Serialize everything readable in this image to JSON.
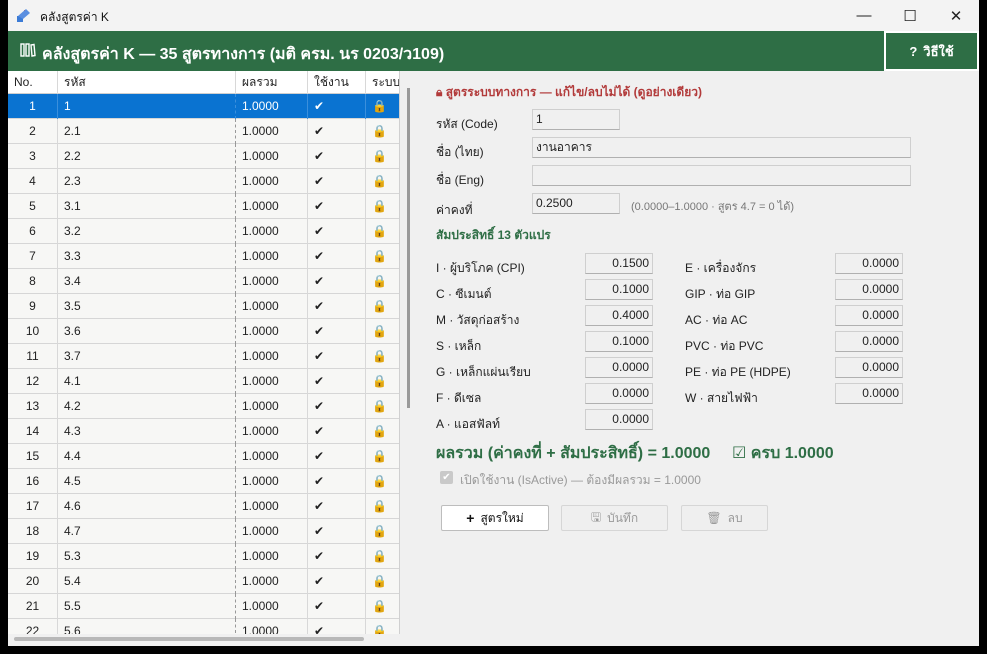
{
  "window": {
    "title": "คลังสูตรค่า K",
    "minimize_glyph": "—",
    "maximize_glyph": "☐",
    "close_glyph": "✕"
  },
  "header": {
    "title": "คลังสูตรค่า K — 35 สูตรทางการ (มติ ครม. นร 0203/ว109)",
    "icon": "library-icon",
    "help_label": "วิธีใช้",
    "help_icon_glyph": "?"
  },
  "grid": {
    "columns": [
      "No.",
      "รหัส",
      "ผลรวม",
      "ใช้งาน",
      "ระบบ"
    ],
    "active_glyph": "✔",
    "system_glyph": "🔒",
    "rows": [
      {
        "no": "1",
        "code": "1",
        "sum": "1.0000"
      },
      {
        "no": "2",
        "code": "2.1",
        "sum": "1.0000"
      },
      {
        "no": "3",
        "code": "2.2",
        "sum": "1.0000"
      },
      {
        "no": "4",
        "code": "2.3",
        "sum": "1.0000"
      },
      {
        "no": "5",
        "code": "3.1",
        "sum": "1.0000"
      },
      {
        "no": "6",
        "code": "3.2",
        "sum": "1.0000"
      },
      {
        "no": "7",
        "code": "3.3",
        "sum": "1.0000"
      },
      {
        "no": "8",
        "code": "3.4",
        "sum": "1.0000"
      },
      {
        "no": "9",
        "code": "3.5",
        "sum": "1.0000"
      },
      {
        "no": "10",
        "code": "3.6",
        "sum": "1.0000"
      },
      {
        "no": "11",
        "code": "3.7",
        "sum": "1.0000"
      },
      {
        "no": "12",
        "code": "4.1",
        "sum": "1.0000"
      },
      {
        "no": "13",
        "code": "4.2",
        "sum": "1.0000"
      },
      {
        "no": "14",
        "code": "4.3",
        "sum": "1.0000"
      },
      {
        "no": "15",
        "code": "4.4",
        "sum": "1.0000"
      },
      {
        "no": "16",
        "code": "4.5",
        "sum": "1.0000"
      },
      {
        "no": "17",
        "code": "4.6",
        "sum": "1.0000"
      },
      {
        "no": "18",
        "code": "4.7",
        "sum": "1.0000"
      },
      {
        "no": "19",
        "code": "5.3",
        "sum": "1.0000"
      },
      {
        "no": "20",
        "code": "5.4",
        "sum": "1.0000"
      },
      {
        "no": "21",
        "code": "5.5",
        "sum": "1.0000"
      },
      {
        "no": "22",
        "code": "5.6",
        "sum": "1.0000"
      }
    ]
  },
  "detail": {
    "lock_notice": "สูตรระบบทางการ — แก้ไข/ลบไม่ได้ (ดูอย่างเดียว)",
    "code_label": "รหัส (Code)",
    "code_value": "1",
    "name_th_label": "ชื่อ (ไทย)",
    "name_th_value": "งานอาคาร",
    "name_en_label": "ชื่อ (Eng)",
    "name_en_value": "",
    "constant_label": "ค่าคงที่",
    "constant_value": "0.2500",
    "constant_hint": "(0.0000–1.0000 · สูตร 4.7 = 0 ได้)",
    "coeff_section": "สัมประสิทธิ์ 13 ตัวแปร",
    "coeff_left": [
      {
        "label": "I · ผู้บริโภค (CPI)",
        "value": "0.1500"
      },
      {
        "label": "C · ซีเมนต์",
        "value": "0.1000"
      },
      {
        "label": "M · วัสดุก่อสร้าง",
        "value": "0.4000"
      },
      {
        "label": "S · เหล็ก",
        "value": "0.1000"
      },
      {
        "label": "G · เหล็กแผ่นเรียบ",
        "value": "0.0000"
      },
      {
        "label": "F · ดีเซล",
        "value": "0.0000"
      },
      {
        "label": "A · แอสฟัลท์",
        "value": "0.0000"
      }
    ],
    "coeff_right": [
      {
        "label": "E · เครื่องจักร",
        "value": "0.0000"
      },
      {
        "label": "GIP · ท่อ GIP",
        "value": "0.0000"
      },
      {
        "label": "AC · ท่อ AC",
        "value": "0.0000"
      },
      {
        "label": "PVC · ท่อ PVC",
        "value": "0.0000"
      },
      {
        "label": "PE · ท่อ PE (HDPE)",
        "value": "0.0000"
      },
      {
        "label": "W · สายไฟฟ้า",
        "value": "0.0000"
      }
    ],
    "total_text": "ผลรวม (ค่าคงที่ + สัมประสิทธิ์) = 1.0000",
    "total_ok_text": "ครบ 1.0000",
    "isactive_label": "เปิดใช้งาน (IsActive) — ต้องมีผลรวม = 1.0000",
    "buttons": {
      "new_label": "สูตรใหม่",
      "save_label": "บันทึก",
      "delete_label": "ลบ"
    }
  },
  "colors": {
    "brand_green": "#2e6e45",
    "selection_blue": "#0a73d1",
    "lock_red": "#b23a3a"
  }
}
